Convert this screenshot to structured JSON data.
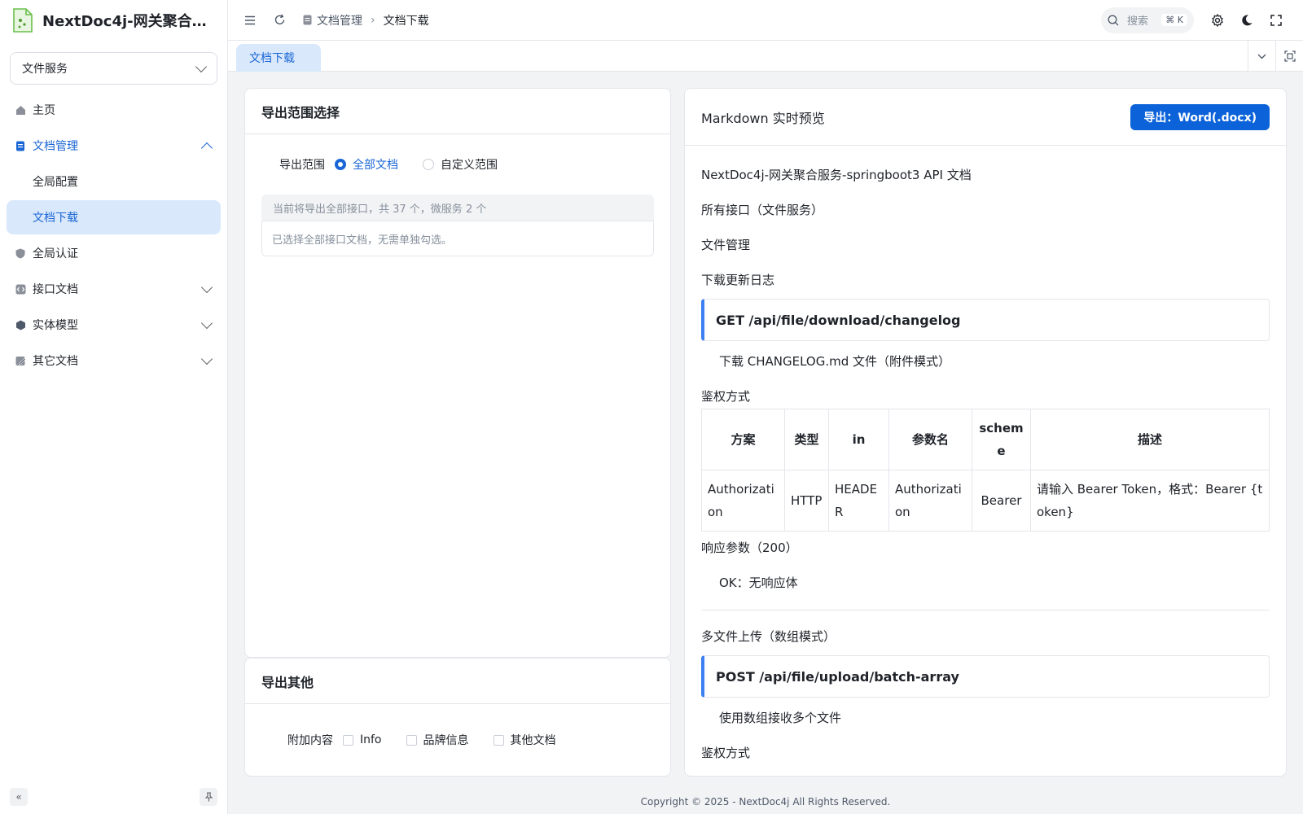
{
  "app": {
    "title": "NextDoc4j-网关聚合服..."
  },
  "service_select": {
    "value": "文件服务"
  },
  "sidebar": {
    "items": [
      {
        "label": "主页"
      },
      {
        "label": "文档管理"
      },
      {
        "label": "全局配置"
      },
      {
        "label": "文档下载"
      },
      {
        "label": "全局认证"
      },
      {
        "label": "接口文档"
      },
      {
        "label": "实体模型"
      },
      {
        "label": "其它文档"
      }
    ]
  },
  "header": {
    "breadcrumb": [
      "文档管理",
      "文档下载"
    ],
    "search_placeholder": "搜索",
    "search_shortcut": "⌘ K"
  },
  "tabs": [
    {
      "label": "文档下载"
    }
  ],
  "export_range": {
    "title": "导出范围选择",
    "range_label": "导出范围",
    "options": [
      "全部文档",
      "自定义范围"
    ],
    "selected": "全部文档",
    "summary": "当前将导出全部接口，共 37 个，微服务 2 个",
    "note": "已选择全部接口文档，无需单独勾选。"
  },
  "export_other": {
    "title": "导出其他",
    "label": "附加内容",
    "options": [
      "Info",
      "品牌信息",
      "其他文档"
    ]
  },
  "preview": {
    "title": "Markdown 实时预览",
    "export_button": "导出：Word(.docx)",
    "doc_title": "NextDoc4j-网关聚合服务-springboot3 API 文档",
    "all_apis": "所有接口（文件服务）",
    "group": "文件管理",
    "ep1": {
      "name": "下载更新日志",
      "method_path": "GET /api/file/download/changelog",
      "desc": "下载 CHANGELOG.md 文件（附件模式）",
      "auth_title": "鉴权方式",
      "table": {
        "headers": [
          "方案",
          "类型",
          "in",
          "参数名",
          "scheme",
          "描述"
        ],
        "row": [
          "Authorization",
          "HTTP",
          "HEADER",
          "Authorization",
          "Bearer",
          "请输入 Bearer Token，格式：Bearer {token}"
        ]
      },
      "resp_title": "响应参数（200）",
      "resp": "OK：无响应体"
    },
    "ep2": {
      "name": "多文件上传（数组模式）",
      "method_path": "POST /api/file/upload/batch-array",
      "desc": "使用数组接收多个文件",
      "auth_title": "鉴权方式"
    }
  },
  "footer": {
    "copyright": "Copyright © 2025 - NextDoc4j All Rights Reserved."
  },
  "colors": {
    "primary": "#1a66d6",
    "selected_bg": "#d9e8fb",
    "button": "#0c63d9"
  }
}
